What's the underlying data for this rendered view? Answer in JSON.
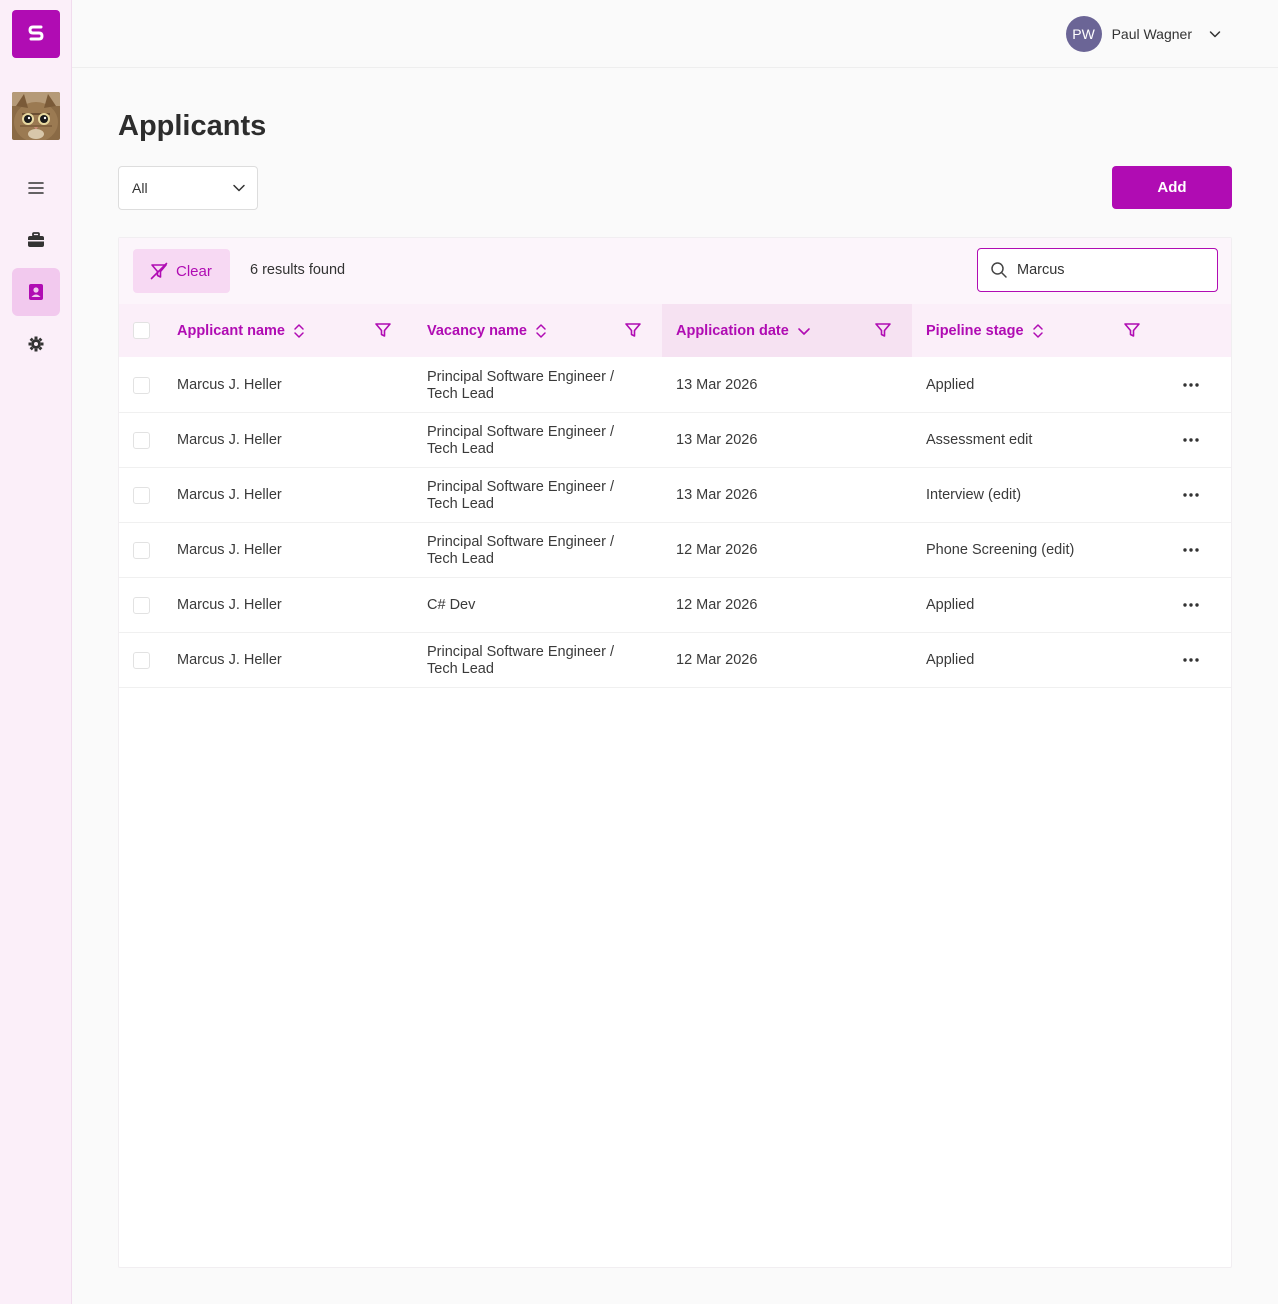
{
  "colors": {
    "accent": "#b00cb3",
    "sidebar_bg": "#fbeff9",
    "avatar_bg": "#6b6596"
  },
  "sidebar": {
    "items": [
      {
        "name": "menu",
        "icon": "hamburger-icon"
      },
      {
        "name": "vacancies",
        "icon": "briefcase-icon"
      },
      {
        "name": "applicants",
        "icon": "contact-card-icon",
        "active": true
      },
      {
        "name": "settings",
        "icon": "gear-icon"
      }
    ]
  },
  "user": {
    "initials": "PW",
    "name": "Paul Wagner"
  },
  "page": {
    "title": "Applicants"
  },
  "filter_select": {
    "value": "All"
  },
  "add_button": {
    "label": "Add"
  },
  "toolbar": {
    "clear_label": "Clear",
    "results_text": "6 results found"
  },
  "search": {
    "value": "Marcus"
  },
  "table": {
    "columns": [
      {
        "label": "Applicant name",
        "sort": "none"
      },
      {
        "label": "Vacancy name",
        "sort": "none"
      },
      {
        "label": "Application date",
        "sort": "desc"
      },
      {
        "label": "Pipeline stage",
        "sort": "none"
      }
    ],
    "rows": [
      {
        "applicant": "Marcus J. Heller",
        "vacancy_line1": "Principal Software Engineer /",
        "vacancy_line2": "Tech Lead",
        "date": "13 Mar 2026",
        "stage": "Applied"
      },
      {
        "applicant": "Marcus J. Heller",
        "vacancy_line1": "Principal Software Engineer /",
        "vacancy_line2": "Tech Lead",
        "date": "13 Mar 2026",
        "stage": "Assessment edit"
      },
      {
        "applicant": "Marcus J. Heller",
        "vacancy_line1": "Principal Software Engineer /",
        "vacancy_line2": "Tech Lead",
        "date": "13 Mar 2026",
        "stage": "Interview (edit)"
      },
      {
        "applicant": "Marcus J. Heller",
        "vacancy_line1": "Principal Software Engineer /",
        "vacancy_line2": "Tech Lead",
        "date": "12 Mar 2026",
        "stage": "Phone Screening (edit)"
      },
      {
        "applicant": "Marcus J. Heller",
        "vacancy_line1": "C# Dev",
        "vacancy_line2": "",
        "date": "12 Mar 2026",
        "stage": "Applied"
      },
      {
        "applicant": "Marcus J. Heller",
        "vacancy_line1": "Principal Software Engineer /",
        "vacancy_line2": "Tech Lead",
        "date": "12 Mar 2026",
        "stage": "Applied"
      }
    ]
  }
}
